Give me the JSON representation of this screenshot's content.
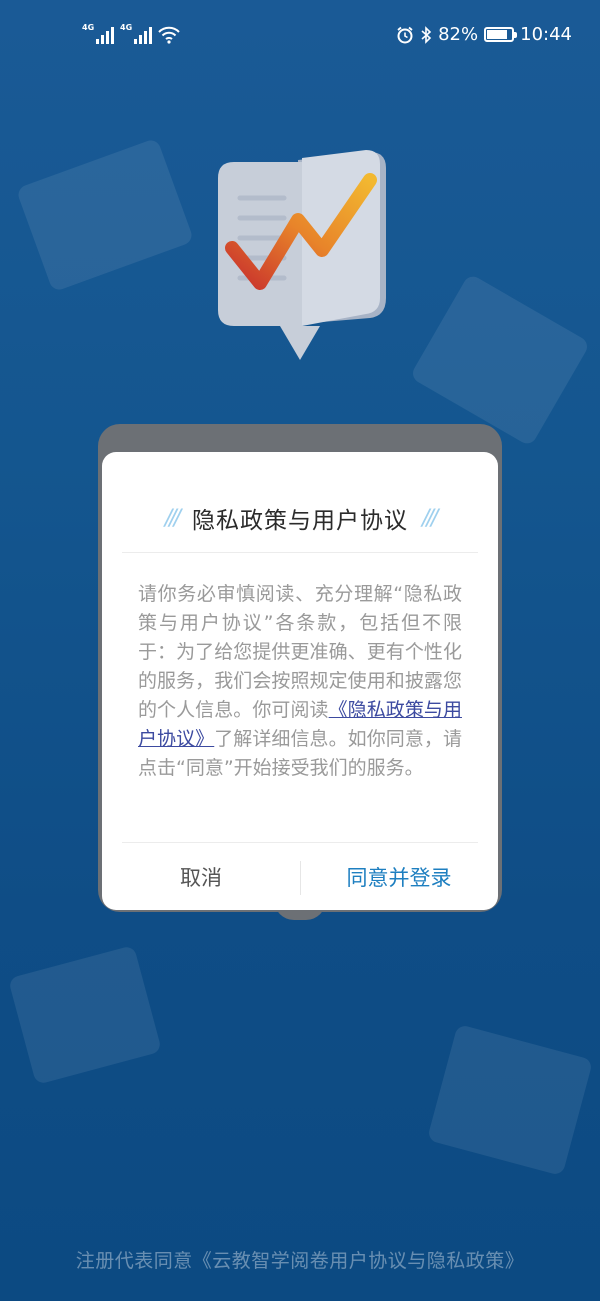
{
  "status_bar": {
    "network1": "4G",
    "network2": "4G",
    "battery_percent": "82%",
    "time": "10:44"
  },
  "dialog": {
    "title": "隐私政策与用户协议",
    "body_pre": "请你务必审慎阅读、充分理解“隐私政策与用户协议”各条款，包括但不限于：为了给您提供更准确、更有个性化的服务，我们会按照规定使用和披露您的个人信息。你可阅读",
    "link_text": "《隐私政策与用户协议》",
    "body_post": "了解详细信息。如你同意，请点击“同意”开始接受我们的服务。",
    "cancel_label": "取消",
    "agree_label": "同意并登录"
  },
  "footer": {
    "text": "注册代表同意《云教智学阅卷用户协议与隐私政策》"
  },
  "colors": {
    "background": "#14568f",
    "link": "#3c4aa0",
    "agree_button": "#1e7fc0"
  }
}
